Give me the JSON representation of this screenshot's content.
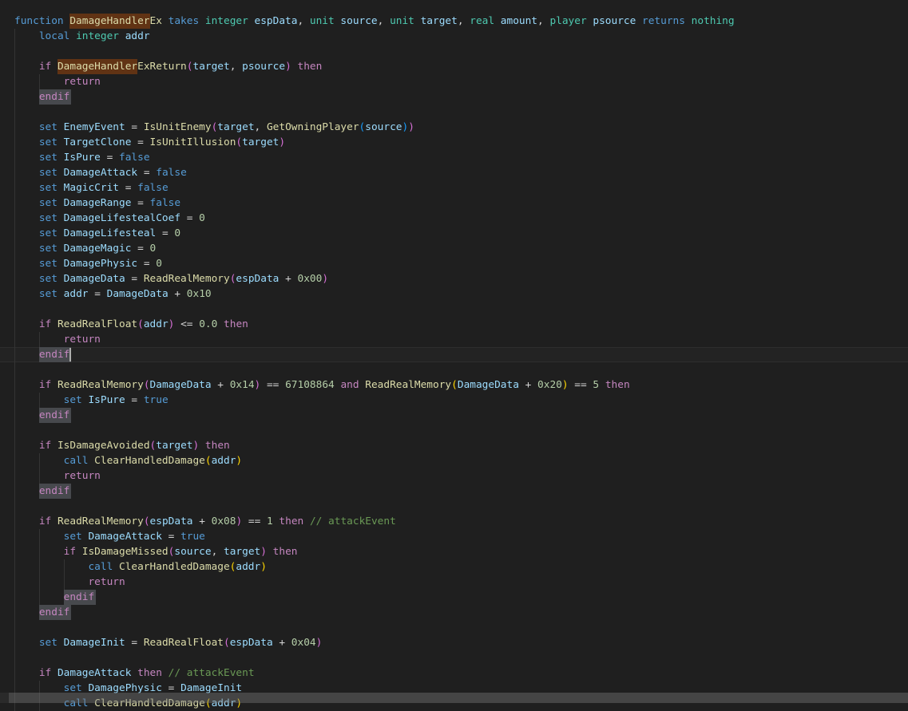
{
  "editor": {
    "background": "#1f1f1f",
    "cursor": {
      "line": 23,
      "col": 9
    },
    "colors": {
      "bg": "#1f1f1f",
      "k": "#569cd6",
      "c": "#c586c0",
      "t": "#4ec9b0",
      "v": "#9cdcfe",
      "f": "#dcdcaa",
      "n": "#b5cea8",
      "o": "#d4d4d4",
      "m": "#6a9955",
      "p1": "#d670d6",
      "p2": "#179fff",
      "p3": "#ffd700",
      "find_bg": "#613314",
      "word_bg": "#47494d",
      "caret": "#aeafad",
      "guide": "#343434",
      "current_border": "#2e2e2e",
      "current_bg": "rgba(255,255,255,0.02)",
      "scrollbar": "#797979",
      "pad": "18px"
    },
    "lines": [
      [
        [
          "k",
          "function "
        ],
        [
          "f fh",
          "DamageHandler"
        ],
        [
          "f",
          "Ex "
        ],
        [
          "k",
          "takes "
        ],
        [
          "t",
          "integer "
        ],
        [
          "v",
          "espData"
        ],
        [
          "o",
          ", "
        ],
        [
          "t",
          "unit "
        ],
        [
          "v",
          "source"
        ],
        [
          "o",
          ", "
        ],
        [
          "t",
          "unit "
        ],
        [
          "v",
          "target"
        ],
        [
          "o",
          ", "
        ],
        [
          "t",
          "real "
        ],
        [
          "v",
          "amount"
        ],
        [
          "o",
          ", "
        ],
        [
          "t",
          "player "
        ],
        [
          "v",
          "psource "
        ],
        [
          "k",
          "returns "
        ],
        [
          "t",
          "nothing"
        ]
      ],
      [
        [
          "w",
          "    "
        ],
        [
          "k",
          "local "
        ],
        [
          "t",
          "integer "
        ],
        [
          "v",
          "addr"
        ]
      ],
      [],
      [
        [
          "w",
          "    "
        ],
        [
          "c",
          "if "
        ],
        [
          "f fh",
          "DamageHandler"
        ],
        [
          "f",
          "ExReturn"
        ],
        [
          "p1",
          "("
        ],
        [
          "v",
          "target"
        ],
        [
          "o",
          ", "
        ],
        [
          "v",
          "psource"
        ],
        [
          "p1",
          ")"
        ],
        [
          "c",
          " then"
        ]
      ],
      [
        [
          "w",
          "        "
        ],
        [
          "c",
          "return"
        ]
      ],
      [
        [
          "w",
          "    "
        ],
        [
          "c wh",
          "endif"
        ]
      ],
      [],
      [
        [
          "w",
          "    "
        ],
        [
          "k",
          "set "
        ],
        [
          "v",
          "EnemyEvent "
        ],
        [
          "o",
          "= "
        ],
        [
          "f",
          "IsUnitEnemy"
        ],
        [
          "p1",
          "("
        ],
        [
          "v",
          "target"
        ],
        [
          "o",
          ", "
        ],
        [
          "f",
          "GetOwningPlayer"
        ],
        [
          "p2",
          "("
        ],
        [
          "v",
          "source"
        ],
        [
          "p2",
          ")"
        ],
        [
          "p1",
          ")"
        ]
      ],
      [
        [
          "w",
          "    "
        ],
        [
          "k",
          "set "
        ],
        [
          "v",
          "TargetClone "
        ],
        [
          "o",
          "= "
        ],
        [
          "f",
          "IsUnitIllusion"
        ],
        [
          "p1",
          "("
        ],
        [
          "v",
          "target"
        ],
        [
          "p1",
          ")"
        ]
      ],
      [
        [
          "w",
          "    "
        ],
        [
          "k",
          "set "
        ],
        [
          "v",
          "IsPure "
        ],
        [
          "o",
          "= "
        ],
        [
          "k",
          "false"
        ]
      ],
      [
        [
          "w",
          "    "
        ],
        [
          "k",
          "set "
        ],
        [
          "v",
          "DamageAttack "
        ],
        [
          "o",
          "= "
        ],
        [
          "k",
          "false"
        ]
      ],
      [
        [
          "w",
          "    "
        ],
        [
          "k",
          "set "
        ],
        [
          "v",
          "MagicCrit "
        ],
        [
          "o",
          "= "
        ],
        [
          "k",
          "false"
        ]
      ],
      [
        [
          "w",
          "    "
        ],
        [
          "k",
          "set "
        ],
        [
          "v",
          "DamageRange "
        ],
        [
          "o",
          "= "
        ],
        [
          "k",
          "false"
        ]
      ],
      [
        [
          "w",
          "    "
        ],
        [
          "k",
          "set "
        ],
        [
          "v",
          "DamageLifestealCoef "
        ],
        [
          "o",
          "= "
        ],
        [
          "n",
          "0"
        ]
      ],
      [
        [
          "w",
          "    "
        ],
        [
          "k",
          "set "
        ],
        [
          "v",
          "DamageLifesteal "
        ],
        [
          "o",
          "= "
        ],
        [
          "n",
          "0"
        ]
      ],
      [
        [
          "w",
          "    "
        ],
        [
          "k",
          "set "
        ],
        [
          "v",
          "DamageMagic "
        ],
        [
          "o",
          "= "
        ],
        [
          "n",
          "0"
        ]
      ],
      [
        [
          "w",
          "    "
        ],
        [
          "k",
          "set "
        ],
        [
          "v",
          "DamagePhysic "
        ],
        [
          "o",
          "= "
        ],
        [
          "n",
          "0"
        ]
      ],
      [
        [
          "w",
          "    "
        ],
        [
          "k",
          "set "
        ],
        [
          "v",
          "DamageData "
        ],
        [
          "o",
          "= "
        ],
        [
          "f",
          "ReadRealMemory"
        ],
        [
          "p1",
          "("
        ],
        [
          "v",
          "espData "
        ],
        [
          "o",
          "+ "
        ],
        [
          "n",
          "0x00"
        ],
        [
          "p1",
          ")"
        ]
      ],
      [
        [
          "w",
          "    "
        ],
        [
          "k",
          "set "
        ],
        [
          "v",
          "addr "
        ],
        [
          "o",
          "= "
        ],
        [
          "v",
          "DamageData "
        ],
        [
          "o",
          "+ "
        ],
        [
          "n",
          "0x10"
        ]
      ],
      [],
      [
        [
          "w",
          "    "
        ],
        [
          "c",
          "if "
        ],
        [
          "f",
          "ReadRealFloat"
        ],
        [
          "p1",
          "("
        ],
        [
          "v",
          "addr"
        ],
        [
          "p1",
          ")"
        ],
        [
          "o",
          " <= "
        ],
        [
          "n",
          "0.0"
        ],
        [
          "c",
          " then"
        ]
      ],
      [
        [
          "w",
          "        "
        ],
        [
          "c",
          "return"
        ]
      ],
      [
        [
          "w",
          "    "
        ],
        [
          "c wh",
          "endif"
        ]
      ],
      [],
      [
        [
          "w",
          "    "
        ],
        [
          "c",
          "if "
        ],
        [
          "f",
          "ReadRealMemory"
        ],
        [
          "p1",
          "("
        ],
        [
          "v",
          "DamageData "
        ],
        [
          "o",
          "+ "
        ],
        [
          "n",
          "0x14"
        ],
        [
          "p1",
          ")"
        ],
        [
          "o",
          " == "
        ],
        [
          "n",
          "67108864"
        ],
        [
          "c",
          " and "
        ],
        [
          "f",
          "ReadRealMemory"
        ],
        [
          "p3",
          "("
        ],
        [
          "v",
          "DamageData "
        ],
        [
          "o",
          "+ "
        ],
        [
          "n",
          "0x20"
        ],
        [
          "p3",
          ")"
        ],
        [
          "o",
          " == "
        ],
        [
          "n",
          "5"
        ],
        [
          "c",
          " then"
        ]
      ],
      [
        [
          "w",
          "        "
        ],
        [
          "k",
          "set "
        ],
        [
          "v",
          "IsPure "
        ],
        [
          "o",
          "= "
        ],
        [
          "k",
          "true"
        ]
      ],
      [
        [
          "w",
          "    "
        ],
        [
          "c wh",
          "endif"
        ]
      ],
      [],
      [
        [
          "w",
          "    "
        ],
        [
          "c",
          "if "
        ],
        [
          "f",
          "IsDamageAvoided"
        ],
        [
          "p1",
          "("
        ],
        [
          "v",
          "target"
        ],
        [
          "p1",
          ")"
        ],
        [
          "c",
          " then"
        ]
      ],
      [
        [
          "w",
          "        "
        ],
        [
          "k",
          "call "
        ],
        [
          "f",
          "ClearHandledDamage"
        ],
        [
          "p3",
          "("
        ],
        [
          "v",
          "addr"
        ],
        [
          "p3",
          ")"
        ]
      ],
      [
        [
          "w",
          "        "
        ],
        [
          "c",
          "return"
        ]
      ],
      [
        [
          "w",
          "    "
        ],
        [
          "c wh",
          "endif"
        ]
      ],
      [],
      [
        [
          "w",
          "    "
        ],
        [
          "c",
          "if "
        ],
        [
          "f",
          "ReadRealMemory"
        ],
        [
          "p1",
          "("
        ],
        [
          "v",
          "espData "
        ],
        [
          "o",
          "+ "
        ],
        [
          "n",
          "0x08"
        ],
        [
          "p1",
          ")"
        ],
        [
          "o",
          " == "
        ],
        [
          "n",
          "1"
        ],
        [
          "c",
          " then"
        ],
        [
          "m",
          " // attackEvent"
        ]
      ],
      [
        [
          "w",
          "        "
        ],
        [
          "k",
          "set "
        ],
        [
          "v",
          "DamageAttack "
        ],
        [
          "o",
          "= "
        ],
        [
          "k",
          "true"
        ]
      ],
      [
        [
          "w",
          "        "
        ],
        [
          "c",
          "if "
        ],
        [
          "f",
          "IsDamageMissed"
        ],
        [
          "p1",
          "("
        ],
        [
          "v",
          "source"
        ],
        [
          "o",
          ", "
        ],
        [
          "v",
          "target"
        ],
        [
          "p1",
          ")"
        ],
        [
          "c",
          " then"
        ]
      ],
      [
        [
          "w",
          "            "
        ],
        [
          "k",
          "call "
        ],
        [
          "f",
          "ClearHandledDamage"
        ],
        [
          "p3",
          "("
        ],
        [
          "v",
          "addr"
        ],
        [
          "p3",
          ")"
        ]
      ],
      [
        [
          "w",
          "            "
        ],
        [
          "c",
          "return"
        ]
      ],
      [
        [
          "w",
          "        "
        ],
        [
          "c wh",
          "endif"
        ]
      ],
      [
        [
          "w",
          "    "
        ],
        [
          "c wh",
          "endif"
        ]
      ],
      [],
      [
        [
          "w",
          "    "
        ],
        [
          "k",
          "set "
        ],
        [
          "v",
          "DamageInit "
        ],
        [
          "o",
          "= "
        ],
        [
          "f",
          "ReadRealFloat"
        ],
        [
          "p1",
          "("
        ],
        [
          "v",
          "espData "
        ],
        [
          "o",
          "+ "
        ],
        [
          "n",
          "0x04"
        ],
        [
          "p1",
          ")"
        ]
      ],
      [],
      [
        [
          "w",
          "    "
        ],
        [
          "c",
          "if "
        ],
        [
          "v",
          "DamageAttack "
        ],
        [
          "c",
          "then"
        ],
        [
          "m",
          " // attackEvent"
        ]
      ],
      [
        [
          "w",
          "        "
        ],
        [
          "k",
          "set "
        ],
        [
          "v",
          "DamagePhysic "
        ],
        [
          "o",
          "= "
        ],
        [
          "v",
          "DamageInit"
        ]
      ],
      [
        [
          "w",
          "        "
        ],
        [
          "k",
          "call "
        ],
        [
          "f",
          "ClearHandledDamage"
        ],
        [
          "p3",
          "("
        ],
        [
          "v",
          "addr"
        ],
        [
          "p3",
          ")"
        ]
      ]
    ]
  }
}
